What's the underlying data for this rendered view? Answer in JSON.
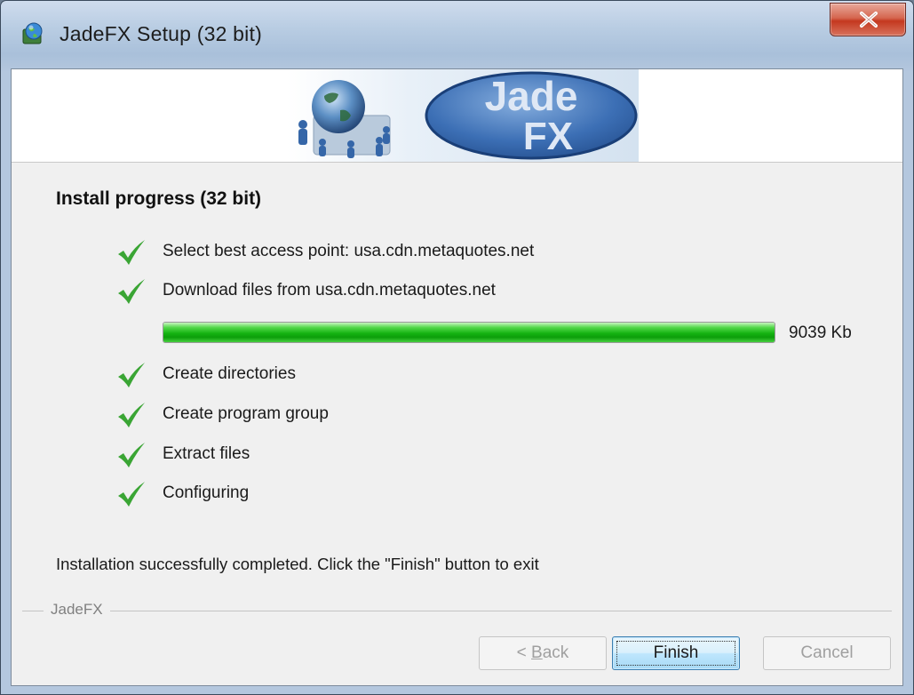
{
  "window": {
    "title": "JadeFX Setup (32 bit)"
  },
  "banner": {
    "logo_line1": "Jade",
    "logo_line2": "FX"
  },
  "page": {
    "heading": "Install progress (32 bit)",
    "steps": [
      {
        "label": "Select best access point: usa.cdn.metaquotes.net",
        "done": true
      },
      {
        "label": "Download files from usa.cdn.metaquotes.net",
        "done": true
      },
      {
        "label": "Create directories",
        "done": true
      },
      {
        "label": "Create program group",
        "done": true
      },
      {
        "label": "Extract files",
        "done": true
      },
      {
        "label": "Configuring",
        "done": true
      }
    ],
    "progress": {
      "percent": 100,
      "size_label": "9039 Kb"
    },
    "status_text": "Installation successfully completed. Click the \"Finish\" button to exit",
    "group_label": "JadeFX"
  },
  "buttons": {
    "back_prefix": "< ",
    "back_mnemonic": "B",
    "back_rest": "ack",
    "finish": "Finish",
    "cancel": "Cancel"
  },
  "colors": {
    "progress_green": "#15b312",
    "check_green": "#3aa534",
    "close_red": "#c4381f"
  },
  "icons": {
    "app": "setup-globe-icon",
    "close": "close-icon",
    "step": "checkmark-icon"
  }
}
